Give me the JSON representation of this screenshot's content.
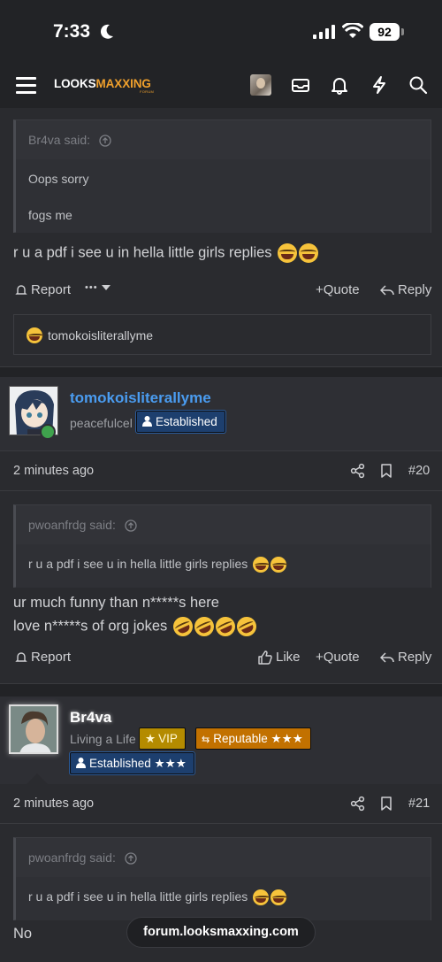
{
  "status_bar": {
    "time": "7:33",
    "battery": "92"
  },
  "nav": {
    "logo_a": "LOOKS",
    "logo_b": "MAXXING",
    "logo_sub": "FORUM"
  },
  "post1": {
    "quote_author": "Br4va said:",
    "quote_lines": [
      "Oops sorry",
      "fogs me"
    ],
    "text": "r u a pdf i see u in hella little girls replies",
    "actions": {
      "report": "Report",
      "more": "•••",
      "quote": "+Quote",
      "reply": "Reply"
    },
    "reaction_user": "tomokoisliterallyme"
  },
  "post2": {
    "username": "tomokoisliterallyme",
    "user_title": "peacefulcel",
    "badge": "Established",
    "time": "2 minutes ago",
    "number": "#20",
    "quote_author": "pwoanfrdg said:",
    "quote_line": "r u a pdf i see u in hella little girls replies",
    "lines": [
      "ur much funny than n*****s here",
      "love n*****s of org jokes"
    ],
    "actions": {
      "report": "Report",
      "like": "Like",
      "quote": "+Quote",
      "reply": "Reply"
    },
    "username_color": "#4a9cf0"
  },
  "post3": {
    "username": "Br4va",
    "user_title": "Living a Life",
    "badges": {
      "vip": "VIP",
      "reputable": "Reputable ★★★",
      "established": "Established ★★★"
    },
    "time": "2 minutes ago",
    "number": "#21",
    "quote_author": "pwoanfrdg said:",
    "quote_line": "r u a pdf i see u in hella little girls replies",
    "text": "No"
  },
  "url_bar": "forum.looksmaxxing.com",
  "colors": {
    "accent": "#f0a02c",
    "background": "#222326",
    "post": "#2a2b2f"
  }
}
